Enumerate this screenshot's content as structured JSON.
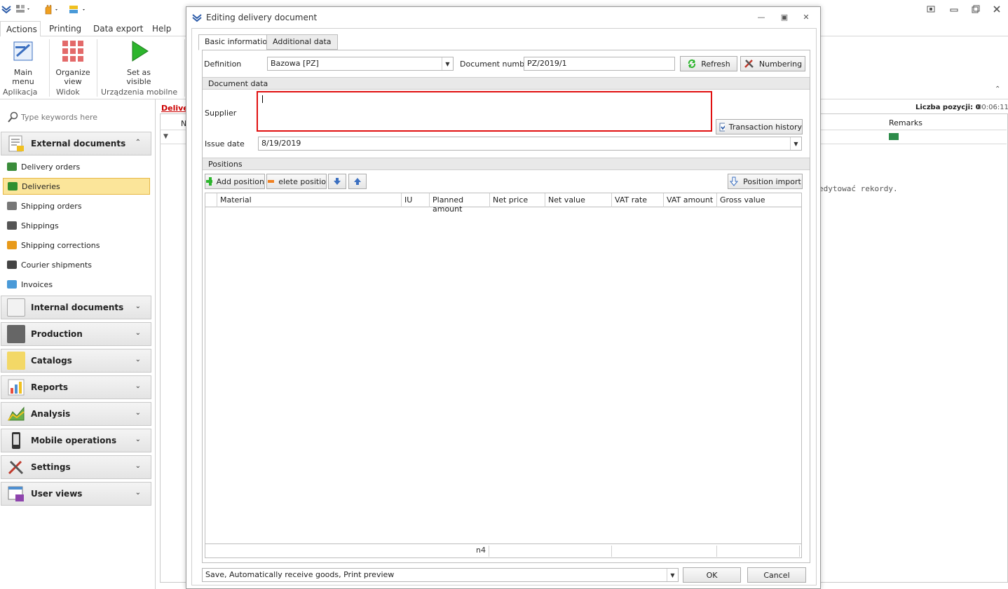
{
  "ribbon": {
    "tabs": [
      "Actions",
      "Printing",
      "Data export",
      "Help"
    ],
    "buttons": {
      "main_menu": "Main menu",
      "organize_view": "Organize view",
      "set_as_visible": "Set as visible"
    },
    "groups": [
      "Aplikacja",
      "Widok",
      "Urządzenia mobilne"
    ]
  },
  "nav": {
    "search_placeholder": "Type keywords here",
    "external_documents": "External documents",
    "items": [
      {
        "label": "Delivery orders",
        "icon": "delivery-order-icon",
        "color": "#3a8c3a"
      },
      {
        "label": "Deliveries",
        "icon": "delivery-truck-icon",
        "color": "#2f8f2f"
      },
      {
        "label": "Shipping orders",
        "icon": "shipping-order-icon",
        "color": "#666666"
      },
      {
        "label": "Shippings",
        "icon": "shipping-truck-icon",
        "color": "#555555"
      },
      {
        "label": "Shipping corrections",
        "icon": "pencil-icon",
        "color": "#e89a1a"
      },
      {
        "label": "Courier shipments",
        "icon": "airplane-icon",
        "color": "#444444"
      },
      {
        "label": "Invoices",
        "icon": "invoice-icon",
        "color": "#4a9ad8"
      }
    ],
    "groups": [
      {
        "label": "Internal documents",
        "icon": "document-icon",
        "color": "#f2f2f2"
      },
      {
        "label": "Production",
        "icon": "production-icon",
        "color": "#666666"
      },
      {
        "label": "Catalogs",
        "icon": "catalog-icon",
        "color": "#f3d866"
      },
      {
        "label": "Reports",
        "icon": "report-chart-icon",
        "color": "#4f8fd0"
      },
      {
        "label": "Analysis",
        "icon": "analysis-chart-icon",
        "color": "#6ab04c"
      },
      {
        "label": "Mobile operations",
        "icon": "mobile-phone-icon",
        "color": "#333333"
      },
      {
        "label": "Settings",
        "icon": "tools-icon",
        "color": "#c0392b"
      },
      {
        "label": "User views",
        "icon": "user-view-icon",
        "color": "#8e44ad"
      }
    ]
  },
  "background": {
    "tab_label": "Deliver",
    "count_label": "Liczba pozycji: 0",
    "timer": "00:06:11",
    "remarks_header": "Remarks",
    "col_n": "N",
    "message_fragment": "edytować rekordy."
  },
  "dialog": {
    "title": "Editing delivery document",
    "tabs": [
      "Basic information",
      "Additional data"
    ],
    "definition_label": "Definition",
    "definition_value": "Bazowa [PZ]",
    "doc_number_label": "Document number",
    "doc_number_value": "PZ/2019/1",
    "refresh_label": "Refresh",
    "numbering_label": "Numbering",
    "document_data_section": "Document data",
    "supplier_label": "Supplier",
    "transaction_history_label": "Transaction history",
    "issue_date_label": "Issue date",
    "issue_date_value": "8/19/2019",
    "positions_section": "Positions",
    "add_position_label": "Add position",
    "delete_position_label": "elete positio",
    "position_import_label": "Position import",
    "grid_columns": [
      "Material",
      "IU",
      "Planned amount",
      "Net price",
      "Net value",
      "VAT rate",
      "VAT amount",
      "Gross value"
    ],
    "footer_value": "n4",
    "bottom_action_value": "Save, Automatically receive goods, Print preview",
    "ok_label": "OK",
    "cancel_label": "Cancel"
  },
  "colors": {
    "accent_red": "#e01010",
    "active_nav": "#fbe59a",
    "tab_red": "#cc0000"
  }
}
